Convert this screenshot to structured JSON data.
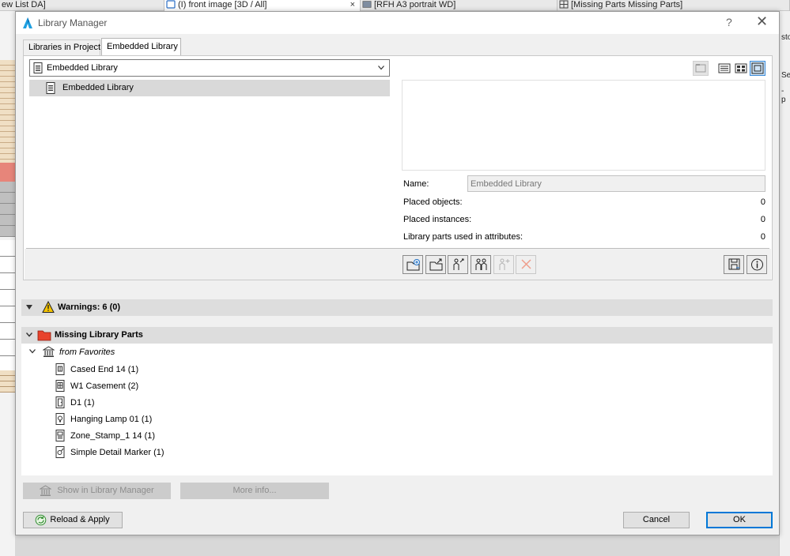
{
  "background_tabs": [
    {
      "label": "ew List DA]"
    },
    {
      "label": "(I) front image [3D / All]",
      "close": "×"
    },
    {
      "label": "[RFH A3 portrait WD]"
    },
    {
      "label": "[Missing Parts Missing Parts]"
    }
  ],
  "background_right": {
    "labels": [
      "sto",
      "Sec",
      "- p"
    ]
  },
  "dialog": {
    "title": "Library Manager",
    "help": "?",
    "close": "✕"
  },
  "tabs": [
    {
      "label": "Libraries in Project"
    },
    {
      "label": "Embedded Library"
    }
  ],
  "library_select": {
    "value": "Embedded Library"
  },
  "tree": {
    "items": [
      {
        "label": "Embedded Library"
      }
    ]
  },
  "info": {
    "name_label": "Name:",
    "name_value": "Embedded Library",
    "placed_objects_label": "Placed objects:",
    "placed_objects_value": "0",
    "placed_instances_label": "Placed instances:",
    "placed_instances_value": "0",
    "parts_in_attributes_label": "Library parts used in attributes:",
    "parts_in_attributes_value": "0"
  },
  "warnings": {
    "label": "Warnings: 6 (0)"
  },
  "missing": {
    "label": "Missing Library Parts",
    "group": "from Favorites",
    "items": [
      {
        "label": "Cased End 14 (1)",
        "icon": "object-icon"
      },
      {
        "label": "W1 Casement (2)",
        "icon": "window-icon"
      },
      {
        "label": "D1 (1)",
        "icon": "door-icon"
      },
      {
        "label": "Hanging Lamp 01 (1)",
        "icon": "lamp-icon"
      },
      {
        "label": "Zone_Stamp_1 14 (1)",
        "icon": "zone-stamp-icon"
      },
      {
        "label": "Simple Detail Marker (1)",
        "icon": "marker-icon"
      }
    ]
  },
  "buttons": {
    "show_in_library_manager": "Show in Library Manager",
    "more_info": "More info...",
    "reload_apply": "Reload & Apply",
    "cancel": "Cancel",
    "ok": "OK"
  },
  "colors": {
    "accent": "#0078d7",
    "warning": "#f5c400",
    "missing_folder": "#e8432d",
    "selected_row": "#d9d9d9"
  }
}
